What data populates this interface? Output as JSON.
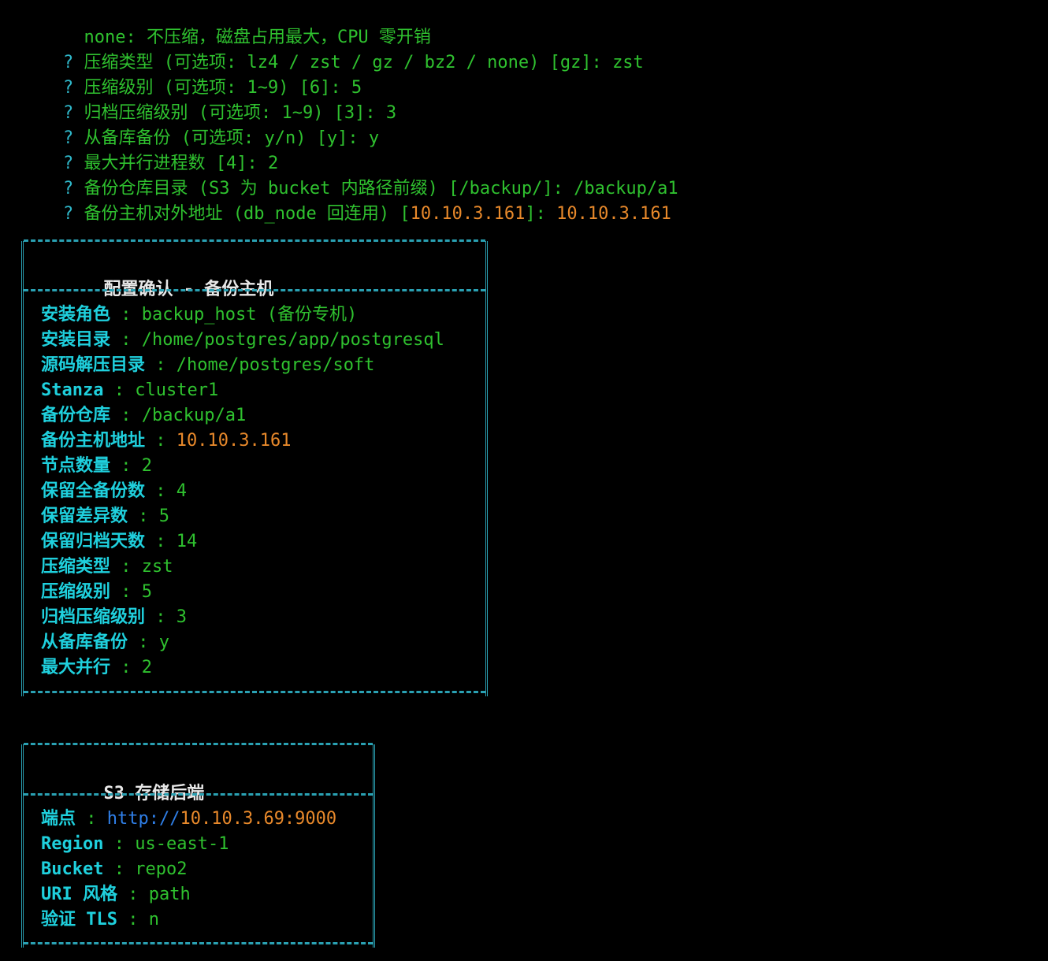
{
  "prompts": {
    "line0": "  none: 不压缩，磁盘占用最大，CPU 零开销",
    "mark": "?",
    "compress_type": {
      "label": "压缩类型 (可选项: lz4 / zst / gz / bz2 / none) [gz]:",
      "value": "zst"
    },
    "compress_level": {
      "label": "压缩级别 (可选项: 1~9) [6]:",
      "value": "5"
    },
    "archive_level": {
      "label": "归档压缩级别 (可选项: 1~9) [3]:",
      "value": "3"
    },
    "standby_backup": {
      "label": "从备库备份 (可选项: y/n) [y]:",
      "value": "y"
    },
    "max_process": {
      "label": "最大并行进程数 [4]:",
      "value": "2"
    },
    "repo_path": {
      "label": "备份仓库目录 (S3 为 bucket 内路径前缀) [/backup/]:",
      "value": "/backup/a1"
    },
    "host_addr": {
      "label_pre": "备份主机对外地址 (db_node 回连用) [",
      "label_ip": "10.10.3.161",
      "label_post": "]:",
      "value": "10.10.3.161"
    }
  },
  "confirm_box": {
    "title": "配置确认 - 备份主机",
    "rows": [
      {
        "key": "安装角色",
        "value": "backup_host (备份专机)"
      },
      {
        "key": "安装目录",
        "value": "/home/postgres/app/postgresql"
      },
      {
        "key": "源码解压目录",
        "value": "/home/postgres/soft"
      },
      {
        "key": "Stanza",
        "value": "cluster1"
      },
      {
        "key": "备份仓库",
        "value": "/backup/a1"
      },
      {
        "key": "备份主机地址",
        "value": "10.10.3.161"
      },
      {
        "key": "节点数量",
        "value": "2"
      },
      {
        "key": "保留全备份数",
        "value": "4"
      },
      {
        "key": "保留差异数",
        "value": "5"
      },
      {
        "key": "保留归档天数",
        "value": "14"
      },
      {
        "key": "压缩类型",
        "value": "zst"
      },
      {
        "key": "压缩级别",
        "value": "5"
      },
      {
        "key": "归档压缩级别",
        "value": "3"
      },
      {
        "key": "从备库备份",
        "value": "y"
      },
      {
        "key": "最大并行",
        "value": "2"
      }
    ]
  },
  "s3_box": {
    "title": "S3 存储后端",
    "rows": [
      {
        "key": "端点",
        "value_scheme": "http://",
        "value": "10.10.3.69:9000"
      },
      {
        "key": "Region",
        "value": "us-east-1"
      },
      {
        "key": "Bucket",
        "value": "repo2"
      },
      {
        "key": "URI 风格",
        "value": "path"
      },
      {
        "key": "验证 TLS",
        "value": "n"
      }
    ]
  },
  "colors": {
    "prompt_green": "#2fc12f",
    "question_cyan": "#2fb7c9",
    "ip_orange": "#e8892b",
    "key_cyan": "#1fd0dd",
    "url_blue": "#2f7fe8",
    "border_teal": "#2aa1b3"
  }
}
